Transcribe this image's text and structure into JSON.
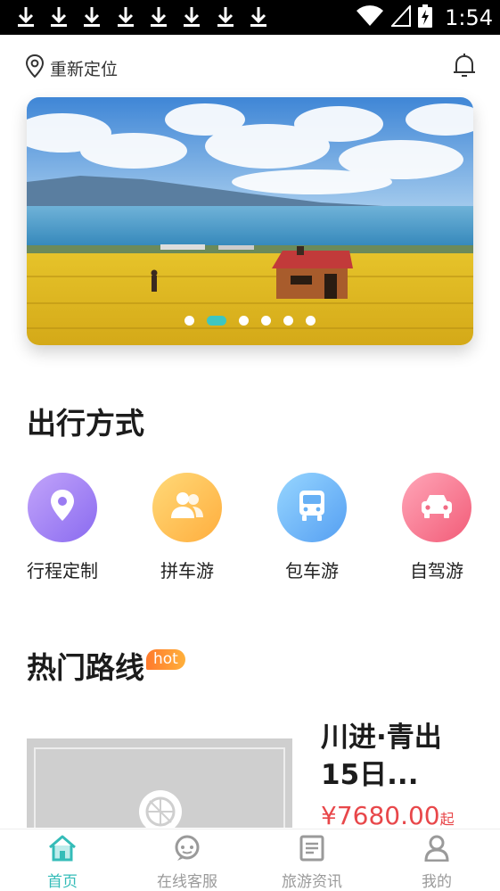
{
  "status_bar": {
    "time": "1:54",
    "download_count": 8
  },
  "header": {
    "location_label": "重新定位"
  },
  "banner": {
    "slide_count": 6,
    "active_index": 1
  },
  "travel_modes": {
    "title": "出行方式",
    "items": [
      {
        "label": "行程定制",
        "icon": "location-pin-icon",
        "color_from": "#b794f6",
        "color_to": "#8d6ef0"
      },
      {
        "label": "拼车游",
        "icon": "people-icon",
        "color_from": "#ffd36b",
        "color_to": "#ffb347"
      },
      {
        "label": "包车游",
        "icon": "bus-icon",
        "color_from": "#8ed0ff",
        "color_to": "#5aa9f5"
      },
      {
        "label": "自驾游",
        "icon": "car-icon",
        "color_from": "#ff9db0",
        "color_to": "#f6667f"
      }
    ]
  },
  "hot_routes": {
    "title": "热门路线",
    "badge": "hot",
    "items": [
      {
        "title": "川进·青出15日...",
        "price": "¥7680.00",
        "price_suffix": "起"
      }
    ]
  },
  "tab_bar": {
    "items": [
      {
        "label": "首页",
        "icon": "home-icon",
        "active": true
      },
      {
        "label": "在线客服",
        "icon": "chat-icon",
        "active": false
      },
      {
        "label": "旅游资讯",
        "icon": "news-icon",
        "active": false
      },
      {
        "label": "我的",
        "icon": "user-icon",
        "active": false
      }
    ]
  },
  "colors": {
    "accent": "#34bcb8",
    "price": "#e8474a",
    "hot_badge": "#ff8a33"
  }
}
